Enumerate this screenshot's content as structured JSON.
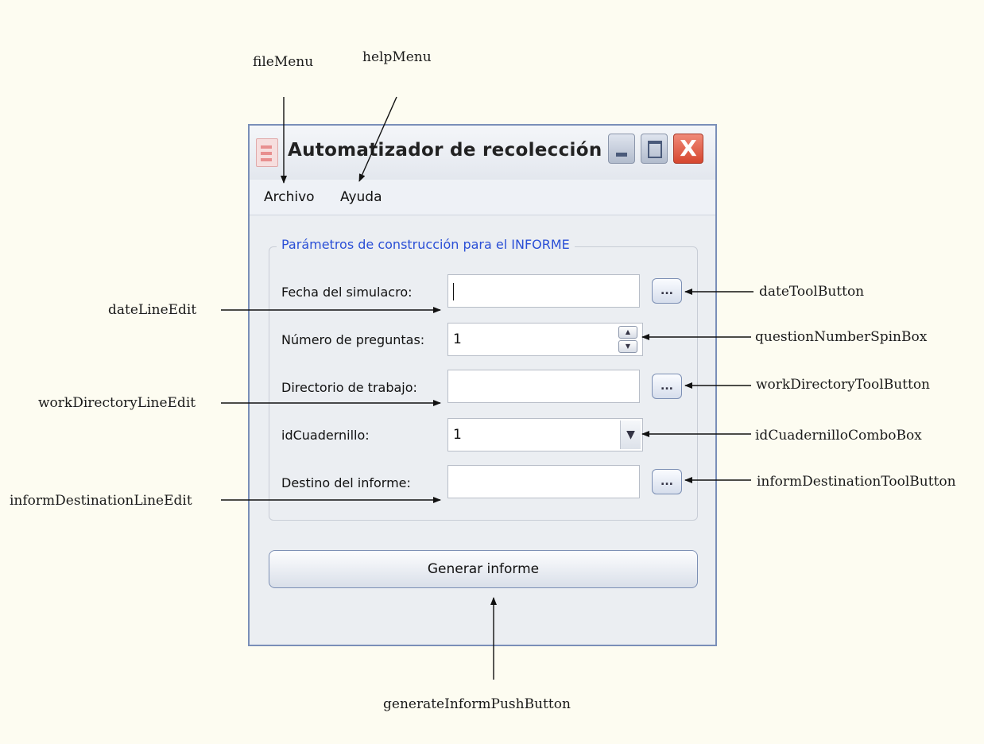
{
  "window": {
    "title": "Automatizador de recolección de ...",
    "close_glyph": "X"
  },
  "menu": {
    "file": "Archivo",
    "help": "Ayuda"
  },
  "group": {
    "title": "Parámetros de construcción para el INFORME"
  },
  "fields": {
    "date_label": "Fecha del simulacro:",
    "date_value": "",
    "questions_label": "Número de preguntas:",
    "questions_value": "1",
    "workdir_label": "Directorio de trabajo:",
    "workdir_value": "",
    "cuadernillo_label": "idCuadernillo:",
    "cuadernillo_value": "1",
    "destination_label": "Destino del informe:",
    "destination_value": ""
  },
  "tool_button_label": "...",
  "generate_button_label": "Generar informe",
  "annotations": {
    "fileMenu": "fileMenu",
    "helpMenu": "helpMenu",
    "dateLineEdit": "dateLineEdit",
    "dateToolButton": "dateToolButton",
    "questionNumberSpinBox": "questionNumberSpinBox",
    "workDirectoryLineEdit": "workDirectoryLineEdit",
    "workDirectoryToolButton": "workDirectoryToolButton",
    "idCuadernilloComboBox": "idCuadernilloComboBox",
    "informDestinationLineEdit": "informDestinationLineEdit",
    "informDestinationToolButton": "informDestinationToolButton",
    "generateInformPushButton": "generateInformPushButton"
  }
}
